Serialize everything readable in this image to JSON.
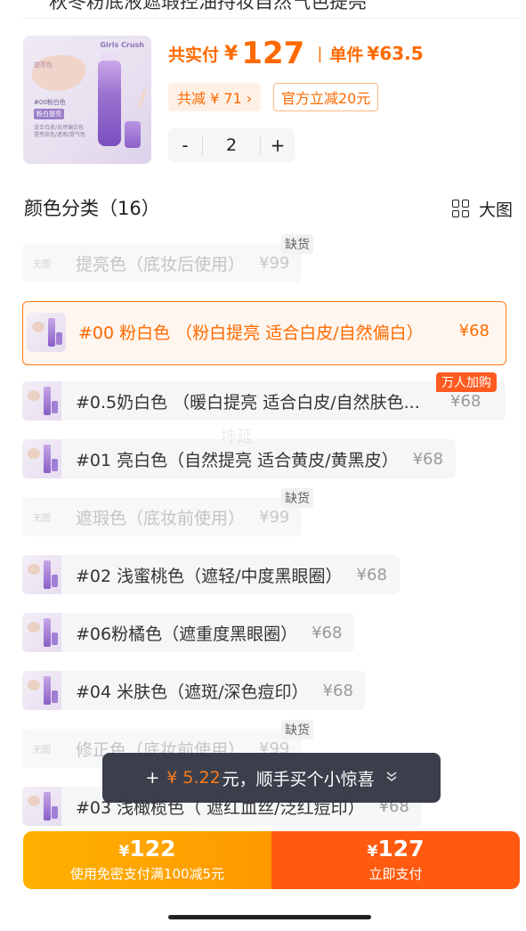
{
  "header": {
    "cut_text": "秋冬粉底液遮瑕控油持妆自然气色提亮"
  },
  "product": {
    "thumb": {
      "brand": "Girls Crush",
      "tag": "提亮色",
      "shade": "#00粉白色",
      "label": "粉白提亮",
      "desc": "适合白皮/自然偏白色 提亮肤色/遮瑕/提气色"
    },
    "total_label": "共实付",
    "total_yen": "¥",
    "total_value": "127",
    "sep": "|",
    "unit_label": "单件",
    "unit_price": "¥63.5",
    "discount_chip": "共减 ¥ 71 ›",
    "official_chip": "官方立减20元",
    "qty_minus": "-",
    "qty": "2",
    "qty_plus": "+"
  },
  "section": {
    "title": "颜色分类（16）",
    "big_view": "大图"
  },
  "badges": {
    "out": "缺货",
    "hot": "万人加购",
    "no_image": "无图"
  },
  "options": [
    {
      "name": "提亮色（底妆后使用）",
      "price": "¥99"
    },
    {
      "name": "#00 粉白色 （粉白提亮 适合白皮/自然偏白）",
      "price": "¥68"
    },
    {
      "name": "#0.5奶白色 （暖白提亮 适合白皮/自然肤色...",
      "price": "¥68"
    },
    {
      "name": "#01 亮白色（自然提亮 适合黄皮/黄黑皮）",
      "price": "¥68"
    },
    {
      "name": "遮瑕色（底妆前使用）",
      "price": "¥99"
    },
    {
      "name": "#02 浅蜜桃色（遮轻/中度黑眼圈）",
      "price": "¥68"
    },
    {
      "name": "#06粉橘色（遮重度黑眼圈）",
      "price": "¥68"
    },
    {
      "name": "#04 米肤色（遮斑/深色痘印）",
      "price": "¥68"
    },
    {
      "name": "修正色（底妆前使用）",
      "price": "¥99"
    },
    {
      "name": "#03 浅橄榄色（ 遮红血丝/泛红痘印）",
      "price": "¥68"
    }
  ],
  "toast": {
    "plus": "+",
    "amount": "¥ 5.22",
    "text": "元，顺手买个小惊喜"
  },
  "footer": {
    "left_yen": "¥",
    "left_amount": "122",
    "left_sub": "使用免密支付满100减5元",
    "right_yen": "¥",
    "right_amount": "127",
    "right_sub": "立即支付"
  },
  "watermark": "坤延",
  "colors": {
    "accent": "#ff6a00",
    "pay_left": "#ffa500",
    "pay_right": "#ff5a0f"
  }
}
